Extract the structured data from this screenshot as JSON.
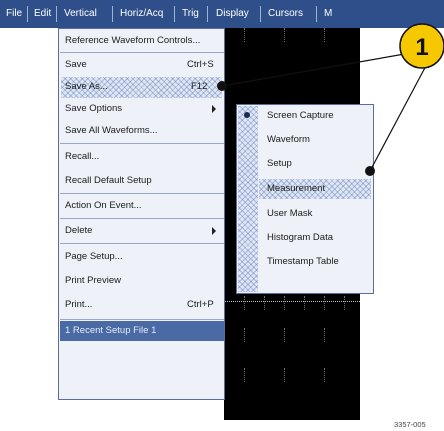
{
  "menubar": {
    "items": [
      "File",
      "Edit",
      "Vertical",
      "Horiz/Acq",
      "Trig",
      "Display",
      "Cursors",
      "M"
    ]
  },
  "file_menu": {
    "items": [
      {
        "label": "Reference Waveform Controls...",
        "shortcut": ""
      },
      {
        "label": "Save",
        "shortcut": "Ctrl+S"
      },
      {
        "label": "Save As...",
        "shortcut": "F12",
        "highlighted": true,
        "has_submenu": true
      },
      {
        "label": "Save Options",
        "shortcut": "",
        "has_submenu": true
      },
      {
        "label": "Save All Waveforms...",
        "shortcut": ""
      },
      {
        "label": "Recall...",
        "shortcut": ""
      },
      {
        "label": "Recall Default Setup",
        "shortcut": ""
      },
      {
        "label": "Action On Event...",
        "shortcut": ""
      },
      {
        "label": "Delete",
        "shortcut": "",
        "has_submenu": true
      },
      {
        "label": "Page Setup...",
        "shortcut": ""
      },
      {
        "label": "Print Preview",
        "shortcut": ""
      },
      {
        "label": "Print...",
        "shortcut": "Ctrl+P"
      },
      {
        "label": "1 Recent Setup File 1",
        "shortcut": "",
        "highlighted": true
      }
    ]
  },
  "save_as_submenu": {
    "items": [
      {
        "label": "Screen Capture"
      },
      {
        "label": "Waveform"
      },
      {
        "label": "Setup"
      },
      {
        "label": "Measurement",
        "highlighted": true
      },
      {
        "label": "User Mask"
      },
      {
        "label": "Histogram Data"
      },
      {
        "label": "Timestamp Table"
      }
    ]
  },
  "callout": {
    "number": "1",
    "color": "#f5c800"
  },
  "figure_id": "3357-005",
  "colors": {
    "menubar": "#2f4f8a",
    "menu_bg": "#eef1f7",
    "highlight_hatch": "#dfe7f4",
    "scope_bg": "#000000"
  }
}
